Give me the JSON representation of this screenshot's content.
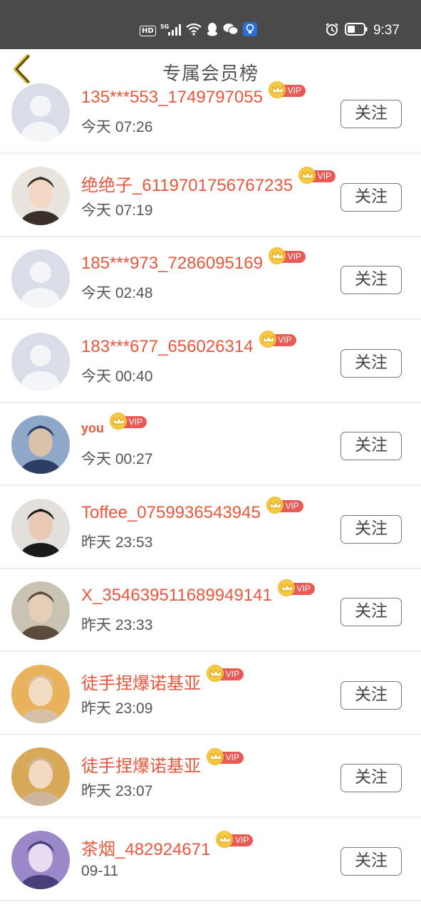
{
  "status_bar": {
    "left_indicators": [
      "HD",
      "5G",
      "signal-icon",
      "wifi-icon",
      "qq-icon",
      "wechat-icon",
      "bulb-icon"
    ],
    "right_indicators": [
      "alarm-icon",
      "battery-icon"
    ],
    "time": "9:37"
  },
  "header": {
    "title": "专属会员榜",
    "back_icon": "chevron-left-icon"
  },
  "colors": {
    "accent_name": "#e8573c",
    "vip_pill": "#e75a55",
    "vip_coin": "#f7c843",
    "status_bar": "#4a4a4a"
  },
  "members": [
    {
      "name": "135***553_1749797055",
      "time": "今天 07:26",
      "vip": "VIP",
      "follow": "关注",
      "avatar": "default"
    },
    {
      "name": "绝绝子_6119701756767235",
      "time": "今天 07:19",
      "vip": "VIP",
      "follow": "关注",
      "avatar": "photo"
    },
    {
      "name": "185***973_7286095169",
      "time": "今天 02:48",
      "vip": "VIP",
      "follow": "关注",
      "avatar": "default"
    },
    {
      "name": "183***677_656026314",
      "time": "今天 00:40",
      "vip": "VIP",
      "follow": "关注",
      "avatar": "default"
    },
    {
      "name": "you",
      "time": "今天 00:27",
      "vip": "VIP",
      "follow": "关注",
      "avatar": "photo"
    },
    {
      "name": "Toffee_0759936543945",
      "time": "昨天 23:53",
      "vip": "VIP",
      "follow": "关注",
      "avatar": "photo"
    },
    {
      "name": "X_354639511689949141",
      "time": "昨天 23:33",
      "vip": "VIP",
      "follow": "关注",
      "avatar": "photo"
    },
    {
      "name": "徒手捏爆诺基亚",
      "time": "昨天 23:09",
      "vip": "VIP",
      "follow": "关注",
      "avatar": "photo"
    },
    {
      "name": "徒手捏爆诺基亚",
      "time": "昨天 23:07",
      "vip": "VIP",
      "follow": "关注",
      "avatar": "photo"
    },
    {
      "name": "茶烟_482924671",
      "time": "09-11",
      "vip": "VIP",
      "follow": "关注",
      "avatar": "photo"
    }
  ]
}
